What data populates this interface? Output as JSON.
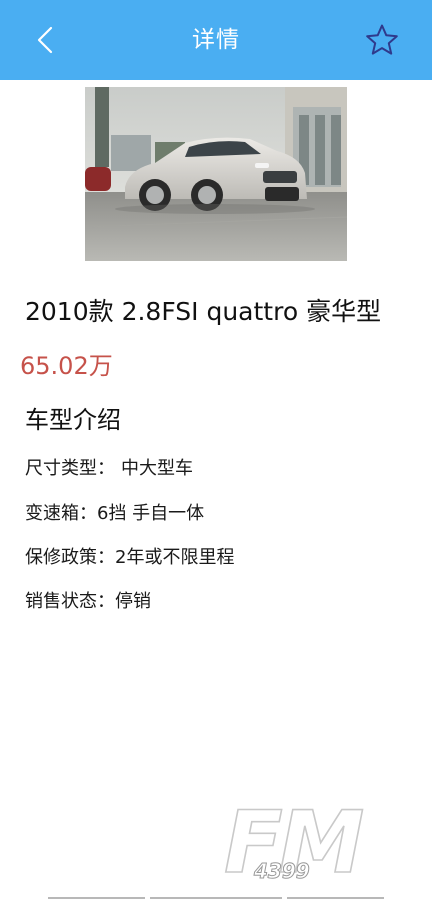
{
  "header": {
    "title": "详情",
    "back_icon": "back-chevron-icon",
    "favorite_icon": "star-outline-icon",
    "background_color": "#4aaef2"
  },
  "car": {
    "photo_subject": "car-photo",
    "name": "2010款 2.8FSI quattro 豪华型",
    "price": "65.02万",
    "price_color": "#c6524a"
  },
  "intro": {
    "title": "车型介绍",
    "specs": [
      {
        "label": "尺寸类型：",
        "value": "中大型车"
      },
      {
        "label": "变速箱：",
        "value": "6挡 手自一体"
      },
      {
        "label": "保修政策：",
        "value": "2年或不限里程"
      },
      {
        "label": "销售状态：",
        "value": "停销"
      }
    ]
  },
  "watermark": {
    "brand": "FM",
    "sub": "4399"
  }
}
